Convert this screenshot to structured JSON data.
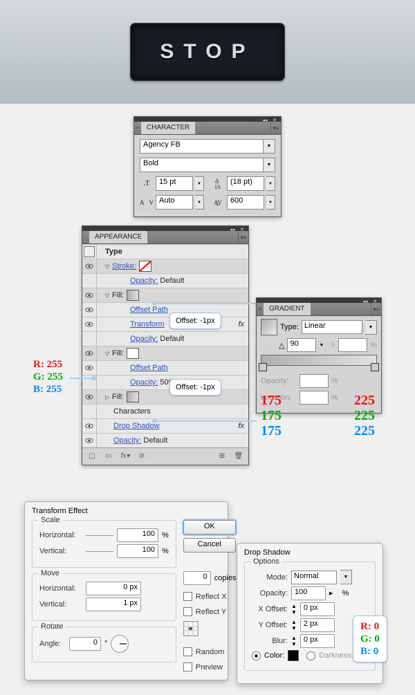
{
  "banner": {
    "text": "STOP"
  },
  "char": {
    "title": "CHARACTER",
    "font": "Agency FB",
    "style": "Bold",
    "size": "15 pt",
    "leading": "(18 pt)",
    "kerning": "Auto",
    "tracking": "600"
  },
  "appearance": {
    "title": "APPEARANCE",
    "rows": {
      "type": "Type",
      "stroke": "Stroke:",
      "opacity": "Opacity:",
      "default": "Default",
      "fill": "Fill:",
      "offsetPath": "Offset Path",
      "transform": "Transform",
      "op50ov": "50% Overlay",
      "characters": "Characters",
      "dropShadow": "Drop Shadow"
    }
  },
  "callouts": {
    "offset1": "Offset: -1px",
    "offset2": "Offset: -1px"
  },
  "rgbWhite": {
    "r": "R: 255",
    "g": "G: 255",
    "b": "B: 255"
  },
  "gradient": {
    "title": "GRADIENT",
    "typeLabel": "Type:",
    "typeValue": "Linear",
    "angle": "90",
    "opacityLabel": "Opacity:",
    "locationLabel": "Location:",
    "pct": "%",
    "left": {
      "r": "175",
      "g": "175",
      "b": "175"
    },
    "right": {
      "r": "225",
      "g": "225",
      "b": "225"
    }
  },
  "transform": {
    "title": "Transform Effect",
    "scale": "Scale",
    "horizontal": "Horizontal:",
    "vertical": "Vertical:",
    "h100": "100",
    "v100": "100",
    "pct": "%",
    "move": "Move",
    "mh": "0 px",
    "mv": "1 px",
    "rotate": "Rotate",
    "angle": "Angle:",
    "angleVal": "0",
    "deg": "°",
    "ok": "OK",
    "cancel": "Cancel",
    "copies": "copies",
    "copiesVal": "0",
    "reflectX": "Reflect X",
    "reflectY": "Reflect Y",
    "random": "Random",
    "preview": "Preview"
  },
  "ds": {
    "title": "Drop Shadow",
    "options": "Options",
    "mode": "Mode:",
    "modeVal": "Normal",
    "opacity": "Opacity:",
    "opVal": "100",
    "pct": "%",
    "xoff": "X Offset:",
    "xVal": "0 px",
    "yoff": "Y Offset:",
    "yVal": "2 px",
    "blur": "Blur:",
    "blurVal": "0 px",
    "color": "Color:",
    "darkness": "Darkness:"
  },
  "rgbBlack": {
    "r": "R: 0",
    "g": "G: 0",
    "b": "B: 0"
  }
}
